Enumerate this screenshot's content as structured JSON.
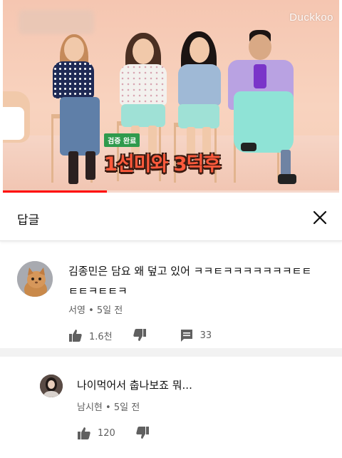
{
  "video": {
    "watermark": "Duckkoo",
    "progress_fraction": 0.31,
    "caption_badge": "검증 완료",
    "caption_main": "1선미와 3덕후"
  },
  "panel": {
    "title": "답글",
    "close_icon": "close-icon"
  },
  "comments": [
    {
      "text_line1": "김종민은 담요 왜 덮고 있어 ㅋㅋㅌㅋㅋㅋㅋㅋㅋㅋㅌㅌ",
      "text_line2": "ㅌㅌㅋㅌㅌㅋ",
      "author": "서영",
      "time": "5일 전",
      "likes": "1.6천",
      "replies": "33"
    },
    {
      "text_line1": "나이먹어서 춥나보죠 뭐...",
      "author": "남시현",
      "time": "5일 전",
      "likes": "120"
    }
  ],
  "colors": {
    "accent": "#ff0000",
    "meta": "#606060",
    "caption_text": "#ff5a3c",
    "caption_badge_bg": "#2f9a4d"
  }
}
